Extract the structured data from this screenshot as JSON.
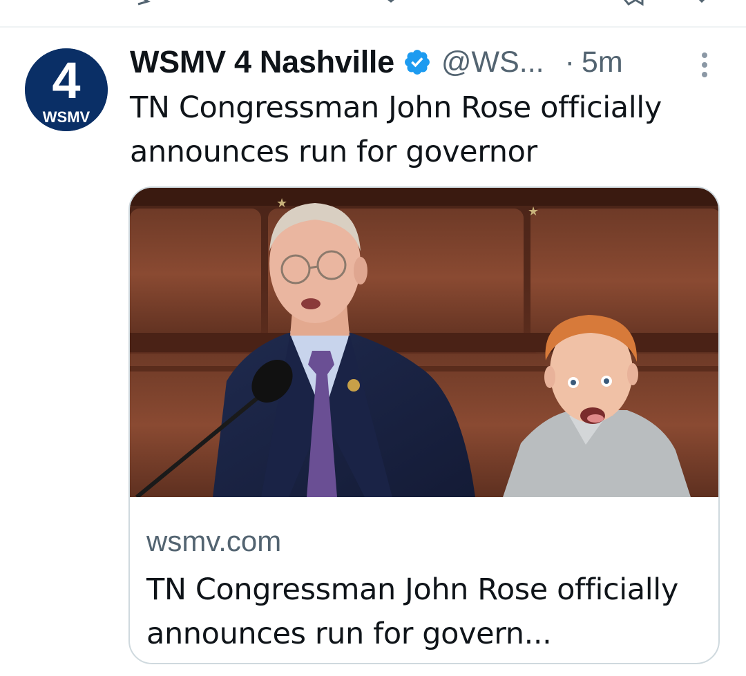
{
  "tweet": {
    "avatar": {
      "number": "4",
      "label": "WSMV"
    },
    "display_name": "WSMV 4 Nashville",
    "handle": "@WS...",
    "separator": "·",
    "time": "5m",
    "text": "TN Congressman John Rose officially announces run for governor",
    "icons": {
      "verified": "verified-badge-icon",
      "more": "more-vertical-icon"
    },
    "card": {
      "domain": "wsmv.com",
      "title": "TN Congressman John Rose officially announces run for govern..."
    }
  },
  "colors": {
    "primary_text": "#0f1419",
    "secondary_text": "#536471",
    "verified_blue": "#1d9bf0",
    "avatar_navy": "#0a2f66",
    "card_border": "#cfd9de"
  }
}
